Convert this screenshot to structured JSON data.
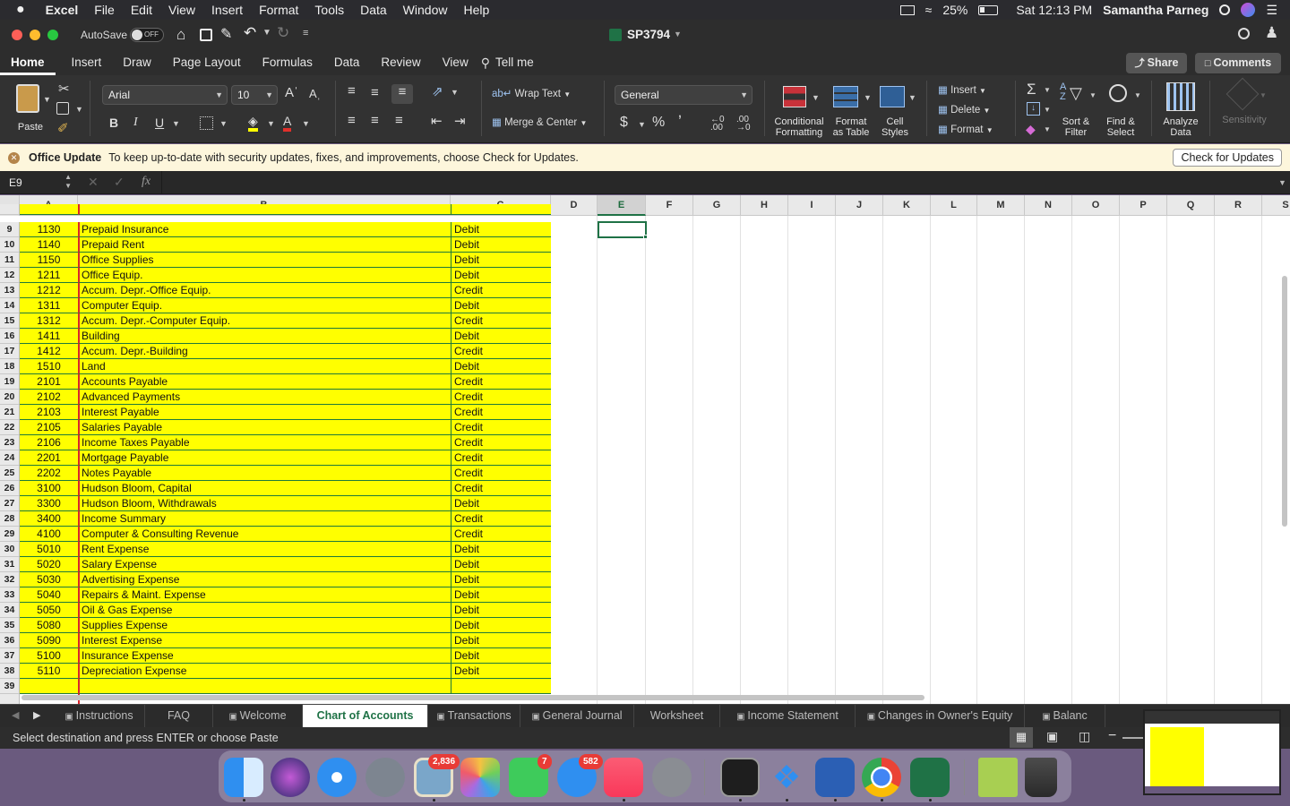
{
  "menubar": {
    "apple": "",
    "items": [
      "Excel",
      "File",
      "Edit",
      "View",
      "Insert",
      "Format",
      "Tools",
      "Data",
      "Window",
      "Help"
    ],
    "battery": "25%",
    "clock": "Sat 12:13 PM",
    "user": "Samantha Parneg"
  },
  "titlebar": {
    "autosave_label": "AutoSave",
    "autosave_state": "OFF",
    "doc_title": "SP3794"
  },
  "ribbon_tabs": [
    "Home",
    "Insert",
    "Draw",
    "Page Layout",
    "Formulas",
    "Data",
    "Review",
    "View",
    "Tell me"
  ],
  "ribbon": {
    "share": "Share",
    "comments": "Comments",
    "paste": "Paste",
    "font_name": "Arial",
    "font_size": "10",
    "wrap_text": "Wrap Text",
    "merge_center": "Merge & Center",
    "number_format": "General",
    "conditional_formatting_1": "Conditional",
    "conditional_formatting_2": "Formatting",
    "format_table_1": "Format",
    "format_table_2": "as Table",
    "cell_styles_1": "Cell",
    "cell_styles_2": "Styles",
    "insert": "Insert",
    "delete": "Delete",
    "format": "Format",
    "sort_filter_1": "Sort &",
    "sort_filter_2": "Filter",
    "find_select_1": "Find &",
    "find_select_2": "Select",
    "analyze_1": "Analyze",
    "analyze_2": "Data",
    "sensitivity": "Sensitivity",
    "bold": "B",
    "italic": "I",
    "underline": "U"
  },
  "update_bar": {
    "title": "Office Update",
    "message": "To keep up-to-date with security updates, fixes, and improvements, choose Check for Updates.",
    "button": "Check for Updates"
  },
  "formula_bar": {
    "name_box": "E9",
    "fx": "fx",
    "value": ""
  },
  "columns": [
    "A",
    "B",
    "C",
    "D",
    "E",
    "F",
    "G",
    "H",
    "I",
    "J",
    "K",
    "L",
    "M",
    "N",
    "O",
    "P",
    "Q",
    "R",
    "S"
  ],
  "selected_cell": "E9",
  "rows": [
    {
      "n": "9",
      "a": "1130",
      "b": "Prepaid Insurance",
      "c": "Debit"
    },
    {
      "n": "10",
      "a": "1140",
      "b": "Prepaid Rent",
      "c": "Debit"
    },
    {
      "n": "11",
      "a": "1150",
      "b": "Office Supplies",
      "c": "Debit"
    },
    {
      "n": "12",
      "a": "1211",
      "b": "Office Equip.",
      "c": "Debit"
    },
    {
      "n": "13",
      "a": "1212",
      "b": "Accum. Depr.-Office Equip.",
      "c": "Credit"
    },
    {
      "n": "14",
      "a": "1311",
      "b": "Computer Equip.",
      "c": "Debit"
    },
    {
      "n": "15",
      "a": "1312",
      "b": "Accum. Depr.-Computer Equip.",
      "c": "Credit"
    },
    {
      "n": "16",
      "a": "1411",
      "b": "Building",
      "c": "Debit"
    },
    {
      "n": "17",
      "a": "1412",
      "b": "Accum. Depr.-Building",
      "c": "Credit"
    },
    {
      "n": "18",
      "a": "1510",
      "b": "Land",
      "c": "Debit"
    },
    {
      "n": "19",
      "a": "2101",
      "b": "Accounts Payable",
      "c": "Credit"
    },
    {
      "n": "20",
      "a": "2102",
      "b": "Advanced Payments",
      "c": "Credit"
    },
    {
      "n": "21",
      "a": "2103",
      "b": "Interest Payable",
      "c": "Credit"
    },
    {
      "n": "22",
      "a": "2105",
      "b": "Salaries Payable",
      "c": "Credit"
    },
    {
      "n": "23",
      "a": "2106",
      "b": "Income Taxes Payable",
      "c": "Credit"
    },
    {
      "n": "24",
      "a": "2201",
      "b": "Mortgage Payable",
      "c": "Credit"
    },
    {
      "n": "25",
      "a": "2202",
      "b": "Notes Payable",
      "c": "Credit"
    },
    {
      "n": "26",
      "a": "3100",
      "b": "Hudson Bloom, Capital",
      "c": "Credit"
    },
    {
      "n": "27",
      "a": "3300",
      "b": "Hudson Bloom, Withdrawals",
      "c": "Debit"
    },
    {
      "n": "28",
      "a": "3400",
      "b": "Income Summary",
      "c": "Credit"
    },
    {
      "n": "29",
      "a": "4100",
      "b": "Computer & Consulting Revenue",
      "c": "Credit"
    },
    {
      "n": "30",
      "a": "5010",
      "b": "Rent Expense",
      "c": "Debit"
    },
    {
      "n": "31",
      "a": "5020",
      "b": "Salary Expense",
      "c": "Debit"
    },
    {
      "n": "32",
      "a": "5030",
      "b": "Advertising Expense",
      "c": "Debit"
    },
    {
      "n": "33",
      "a": "5040",
      "b": "Repairs & Maint. Expense",
      "c": "Debit"
    },
    {
      "n": "34",
      "a": "5050",
      "b": "Oil & Gas Expense",
      "c": "Debit"
    },
    {
      "n": "35",
      "a": "5080",
      "b": "Supplies Expense",
      "c": "Debit"
    },
    {
      "n": "36",
      "a": "5090",
      "b": "Interest Expense",
      "c": "Debit"
    },
    {
      "n": "37",
      "a": "5100",
      "b": "Insurance Expense",
      "c": "Debit"
    },
    {
      "n": "38",
      "a": "5110",
      "b": "Depreciation Expense",
      "c": "Debit"
    },
    {
      "n": "39",
      "a": "",
      "b": "",
      "c": ""
    }
  ],
  "sheet_tabs": [
    {
      "label": "Instructions",
      "locked": true
    },
    {
      "label": "FAQ",
      "locked": false
    },
    {
      "label": "Welcome",
      "locked": true
    },
    {
      "label": "Chart of Accounts",
      "locked": false,
      "active": true
    },
    {
      "label": "Transactions",
      "locked": true
    },
    {
      "label": "General Journal",
      "locked": true
    },
    {
      "label": "Worksheet",
      "locked": false
    },
    {
      "label": "Income Statement",
      "locked": true
    },
    {
      "label": "Changes in Owner's Equity",
      "locked": true
    },
    {
      "label": "Balanc",
      "locked": true
    }
  ],
  "status": {
    "message": "Select destination and press ENTER or choose Paste"
  },
  "dock": {
    "badges": {
      "preview": "2,836",
      "facetime": "7",
      "messages": "582"
    }
  },
  "colors": {
    "account_fill": "#ffff00",
    "excel_green": "#1f7246",
    "border_red": "#d9262c"
  }
}
